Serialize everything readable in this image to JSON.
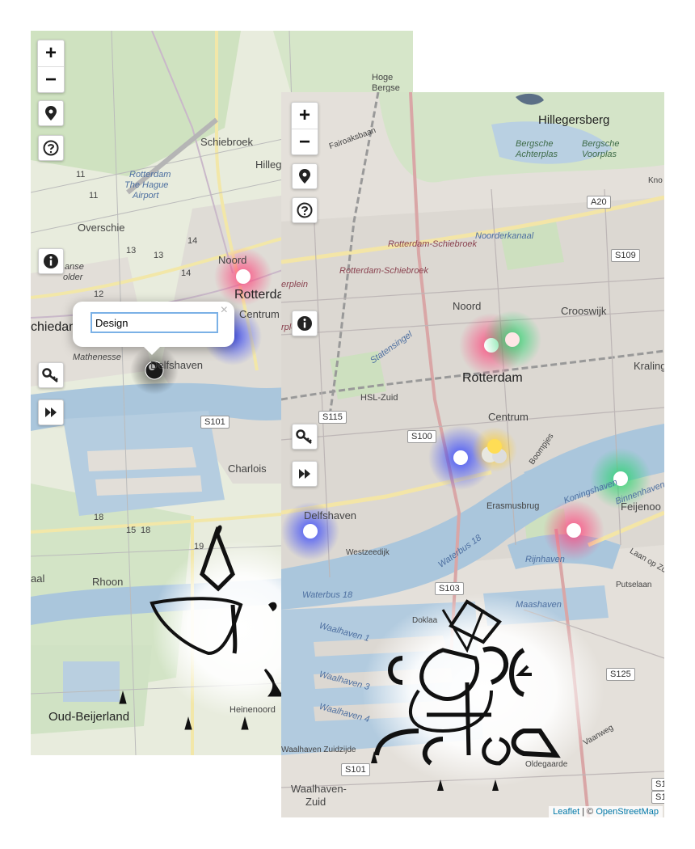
{
  "map_left": {
    "controls": {
      "zoom_in": "+",
      "zoom_out": "−",
      "buttons": [
        "location-pin-icon",
        "help-icon",
        "info-icon",
        "key-icon",
        "fast-forward-icon"
      ]
    },
    "popup": {
      "input_value": "Design",
      "close": "×"
    },
    "labels": {
      "hoge_bergse_1": "Hoge",
      "hoge_bergse_2": "Bergse",
      "schiebroek": "Schiebroek",
      "hillegersberg_partial": "Hilleg",
      "airport_1": "Rotterdam",
      "airport_2": "The Hague",
      "airport_3": "Airport",
      "overschie": "Overschie",
      "noord": "Noord",
      "rotterdam": "Rotterdam",
      "centrum": "Centrum",
      "schiedam": "chiedam",
      "mathenesse": "Mathenesse",
      "delfshaven": "Delfshaven",
      "charlois": "Charlois",
      "rhoon": "Rhoon",
      "oud_beijerland": "Oud-Beijerland",
      "heinenoord": "Heinenoord",
      "polder_1": "anse",
      "polder_2": "older",
      "oud_partial": "aal",
      "s101": "S101"
    },
    "road_numbers": [
      "11",
      "11",
      "13",
      "13",
      "12",
      "14",
      "14",
      "18",
      "18",
      "15",
      "19"
    ]
  },
  "map_right": {
    "controls": {
      "zoom_in": "+",
      "zoom_out": "−",
      "buttons": [
        "location-pin-icon",
        "help-icon",
        "info-icon",
        "key-icon",
        "fast-forward-icon"
      ]
    },
    "labels": {
      "hillegersberg": "Hillegersberg",
      "bergsche_1": "Bergsche",
      "bergsche_2": "Achterplas",
      "bergsche_3": "Bergsche",
      "bergsche_4": "Voorplas",
      "fairoaksbaan": "Fairoaksbaan",
      "rail_1": "Rotterdam-Schiebroek",
      "rail_2": "Rotterdam-Schiebroek",
      "noorderkanaal": "Noorderkanaal",
      "erplein_1": "erplein",
      "erplein_2": "rplein",
      "noord": "Noord",
      "crooswijk": "Crooswijk",
      "kralingen": "Kraling",
      "rotterdam": "Rotterdam",
      "statensingel": "Statensingel",
      "hsl_zuid": "HSL-Zuid",
      "centrum": "Centrum",
      "boompjes": "Boompjes",
      "delfshaven": "Delfshaven",
      "westzeedijk": "Westzeedijk",
      "erasmusbrug": "Erasmusbrug",
      "feijenoord": "Feijenoo",
      "binnenhaven": "Binnenhaven",
      "koningshaven": "Koningshaven",
      "rijnhaven": "Rijnhaven",
      "maashaven": "Maashaven",
      "putselaan": "Putselaan",
      "waterbus_1": "Waterbus 18",
      "waterbus_2": "Waterbus 18",
      "waalhaven_1": "Waalhaven 1",
      "waalhaven_2": "Waalhaven 3",
      "waalhaven_3": "Waalhaven 4",
      "waalhaven_zz": "Waalhaven Zuidzijde",
      "waalhaven_zuid_1": "Waalhaven-",
      "waalhaven_zuid_2": "Zuid",
      "oldegaarde": "Oldegaarde",
      "doklaan": "Doklaa",
      "knoop": "Kno",
      "laan_op_zuid": "Laan op Zuid",
      "vaanweg": "Vaanweg"
    },
    "shields": [
      "A20",
      "S109",
      "S115",
      "S100",
      "S103",
      "S125",
      "S101",
      "S1",
      "S1"
    ],
    "attribution": {
      "leaflet": "Leaflet",
      "separator": "|",
      "copyright": "©",
      "osm": "OpenStreetMap"
    }
  },
  "marker_colors": {
    "pink": "#ff3f78",
    "blue": "#2a3cff",
    "green": "#22d46a",
    "yellow": "#ffcc22",
    "active_marker": "#1a1a1a"
  }
}
